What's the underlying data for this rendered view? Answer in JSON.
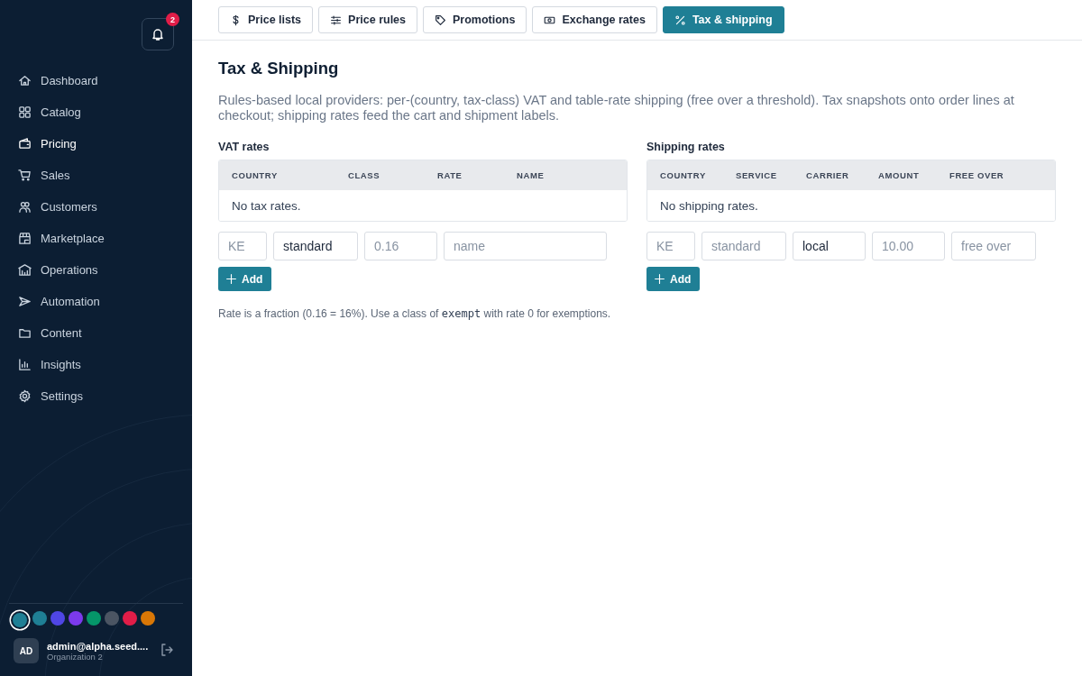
{
  "notifications": {
    "count": "2"
  },
  "nav": [
    {
      "label": "Dashboard",
      "selected": false
    },
    {
      "label": "Catalog",
      "selected": false
    },
    {
      "label": "Pricing",
      "selected": true
    },
    {
      "label": "Sales",
      "selected": false
    },
    {
      "label": "Customers",
      "selected": false
    },
    {
      "label": "Marketplace",
      "selected": false
    },
    {
      "label": "Operations",
      "selected": false
    },
    {
      "label": "Automation",
      "selected": false
    },
    {
      "label": "Content",
      "selected": false
    },
    {
      "label": "Insights",
      "selected": false
    },
    {
      "label": "Settings",
      "selected": false
    }
  ],
  "themes": [
    {
      "color": "#1f7f95",
      "selected": true
    },
    {
      "color": "#1f7f95",
      "selected": false
    },
    {
      "color": "#4f46e5",
      "selected": false
    },
    {
      "color": "#7c3aed",
      "selected": false
    },
    {
      "color": "#059669",
      "selected": false
    },
    {
      "color": "#4b5563",
      "selected": false
    },
    {
      "color": "#e11d48",
      "selected": false
    },
    {
      "color": "#d97706",
      "selected": false
    }
  ],
  "user": {
    "initials": "AD",
    "email": "admin@alpha.seed....",
    "org": "Organization 2"
  },
  "tabs": [
    {
      "label": "Price lists",
      "selected": false
    },
    {
      "label": "Price rules",
      "selected": false
    },
    {
      "label": "Promotions",
      "selected": false
    },
    {
      "label": "Exchange rates",
      "selected": false
    },
    {
      "label": "Tax & shipping",
      "selected": true
    }
  ],
  "title": "Tax & Shipping",
  "description": "Rules-based local providers: per-(country, tax-class) VAT and table-rate shipping (free over a threshold). Tax snapshots onto order lines at checkout; shipping rates feed the cart and shipment labels.",
  "sections": [
    {
      "heading": "VAT rates",
      "columns": [
        "COUNTRY",
        "CLASS",
        "RATE",
        "NAME"
      ],
      "empty": "No tax rates.",
      "fields": [
        {
          "placeholder": "KE"
        },
        {
          "value": "standard"
        },
        {
          "placeholder": "0.16"
        },
        {
          "placeholder": "name"
        }
      ],
      "button": "Add",
      "note": [
        {
          "kind": "text",
          "text": "Rate is a fraction (0.16 = 16%). Use a class of "
        },
        {
          "kind": "code",
          "text": "exempt"
        },
        {
          "kind": "text",
          "text": " with rate 0 for exemptions."
        }
      ]
    },
    {
      "heading": "Shipping rates",
      "columns": [
        "COUNTRY",
        "SERVICE",
        "CARRIER",
        "AMOUNT",
        "FREE OVER"
      ],
      "empty": "No shipping rates.",
      "fields": [
        {
          "placeholder": "KE"
        },
        {
          "placeholder": "standard"
        },
        {
          "value": "local"
        },
        {
          "placeholder": "10.00"
        },
        {
          "placeholder": "free over"
        }
      ],
      "button": "Add"
    }
  ]
}
